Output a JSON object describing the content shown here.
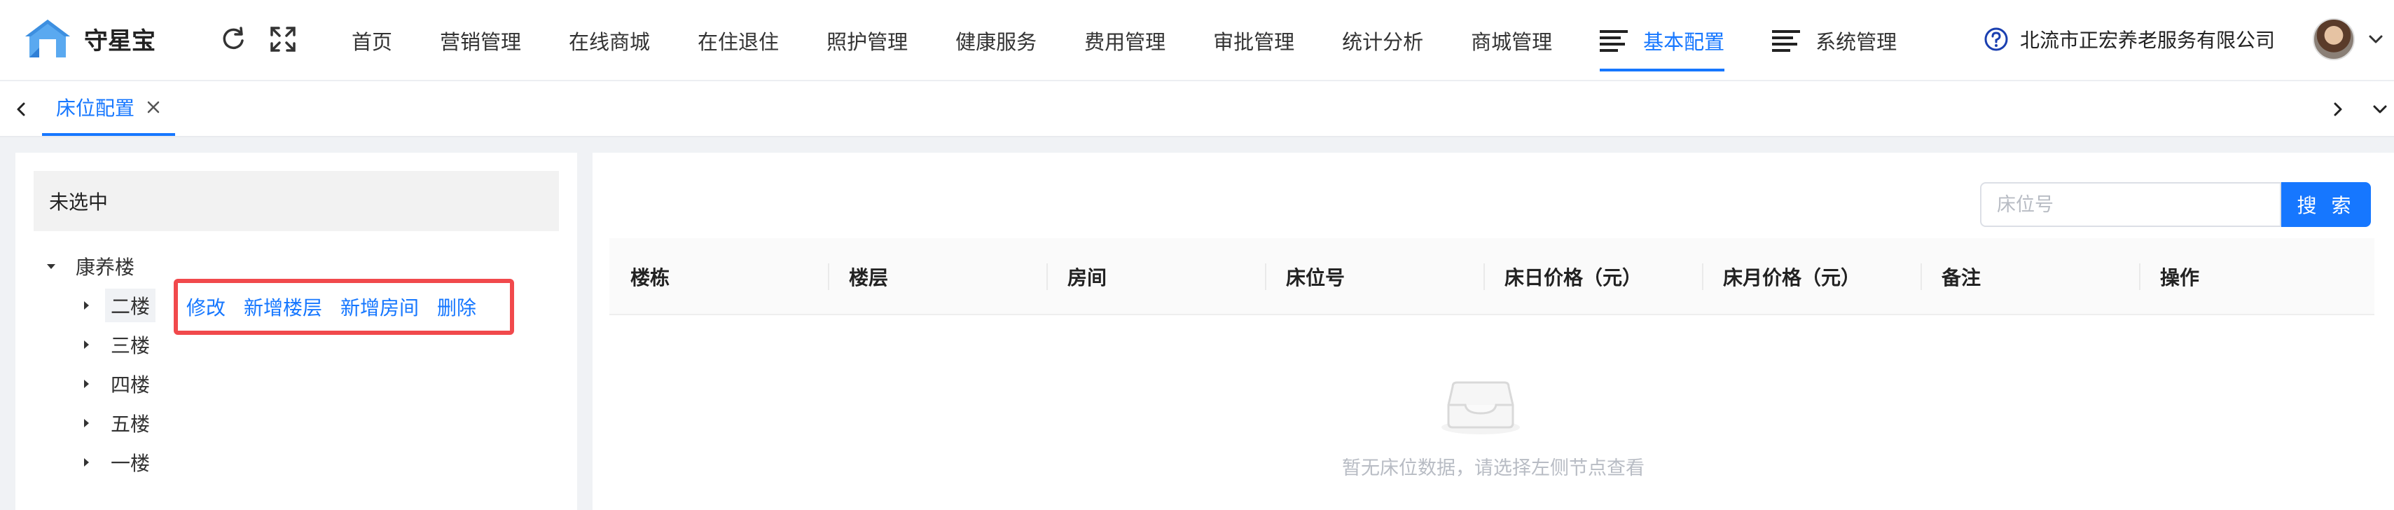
{
  "app": {
    "name": "守星宝"
  },
  "nav": {
    "items": [
      {
        "label": "首页",
        "active": false,
        "icon": null
      },
      {
        "label": "营销管理",
        "active": false,
        "icon": null
      },
      {
        "label": "在线商城",
        "active": false,
        "icon": null
      },
      {
        "label": "在住退住",
        "active": false,
        "icon": null
      },
      {
        "label": "照护管理",
        "active": false,
        "icon": null
      },
      {
        "label": "健康服务",
        "active": false,
        "icon": null
      },
      {
        "label": "费用管理",
        "active": false,
        "icon": null
      },
      {
        "label": "审批管理",
        "active": false,
        "icon": null
      },
      {
        "label": "统计分析",
        "active": false,
        "icon": null
      },
      {
        "label": "商城管理",
        "active": false,
        "icon": null
      },
      {
        "label": "基本配置",
        "active": true,
        "icon": "menu-lines-icon"
      },
      {
        "label": "系统管理",
        "active": false,
        "icon": "menu-lines-icon"
      }
    ]
  },
  "header": {
    "organization": "北流市正宏养老服务有限公司"
  },
  "tabs": [
    {
      "label": "床位配置",
      "active": true
    }
  ],
  "tree": {
    "selected_text": "未选中",
    "root": {
      "label": "康养楼",
      "expanded": true
    },
    "floors": [
      {
        "label": "二楼"
      },
      {
        "label": "三楼"
      },
      {
        "label": "四楼"
      },
      {
        "label": "五楼"
      },
      {
        "label": "一楼"
      }
    ],
    "actions": [
      "修改",
      "新增楼层",
      "新增房间",
      "删除"
    ]
  },
  "search": {
    "placeholder": "床位号",
    "value": "",
    "button_label": "搜 索"
  },
  "table": {
    "columns": [
      "楼栋",
      "楼层",
      "房间",
      "床位号",
      "床日价格（元）",
      "床月价格（元）",
      "备注",
      "操作"
    ],
    "rows": [],
    "empty_text": "暂无床位数据，请选择左侧节点查看"
  },
  "colors": {
    "accent": "#1677ff",
    "highlight_border": "#f1494c",
    "logo": "#5aa9f0"
  }
}
